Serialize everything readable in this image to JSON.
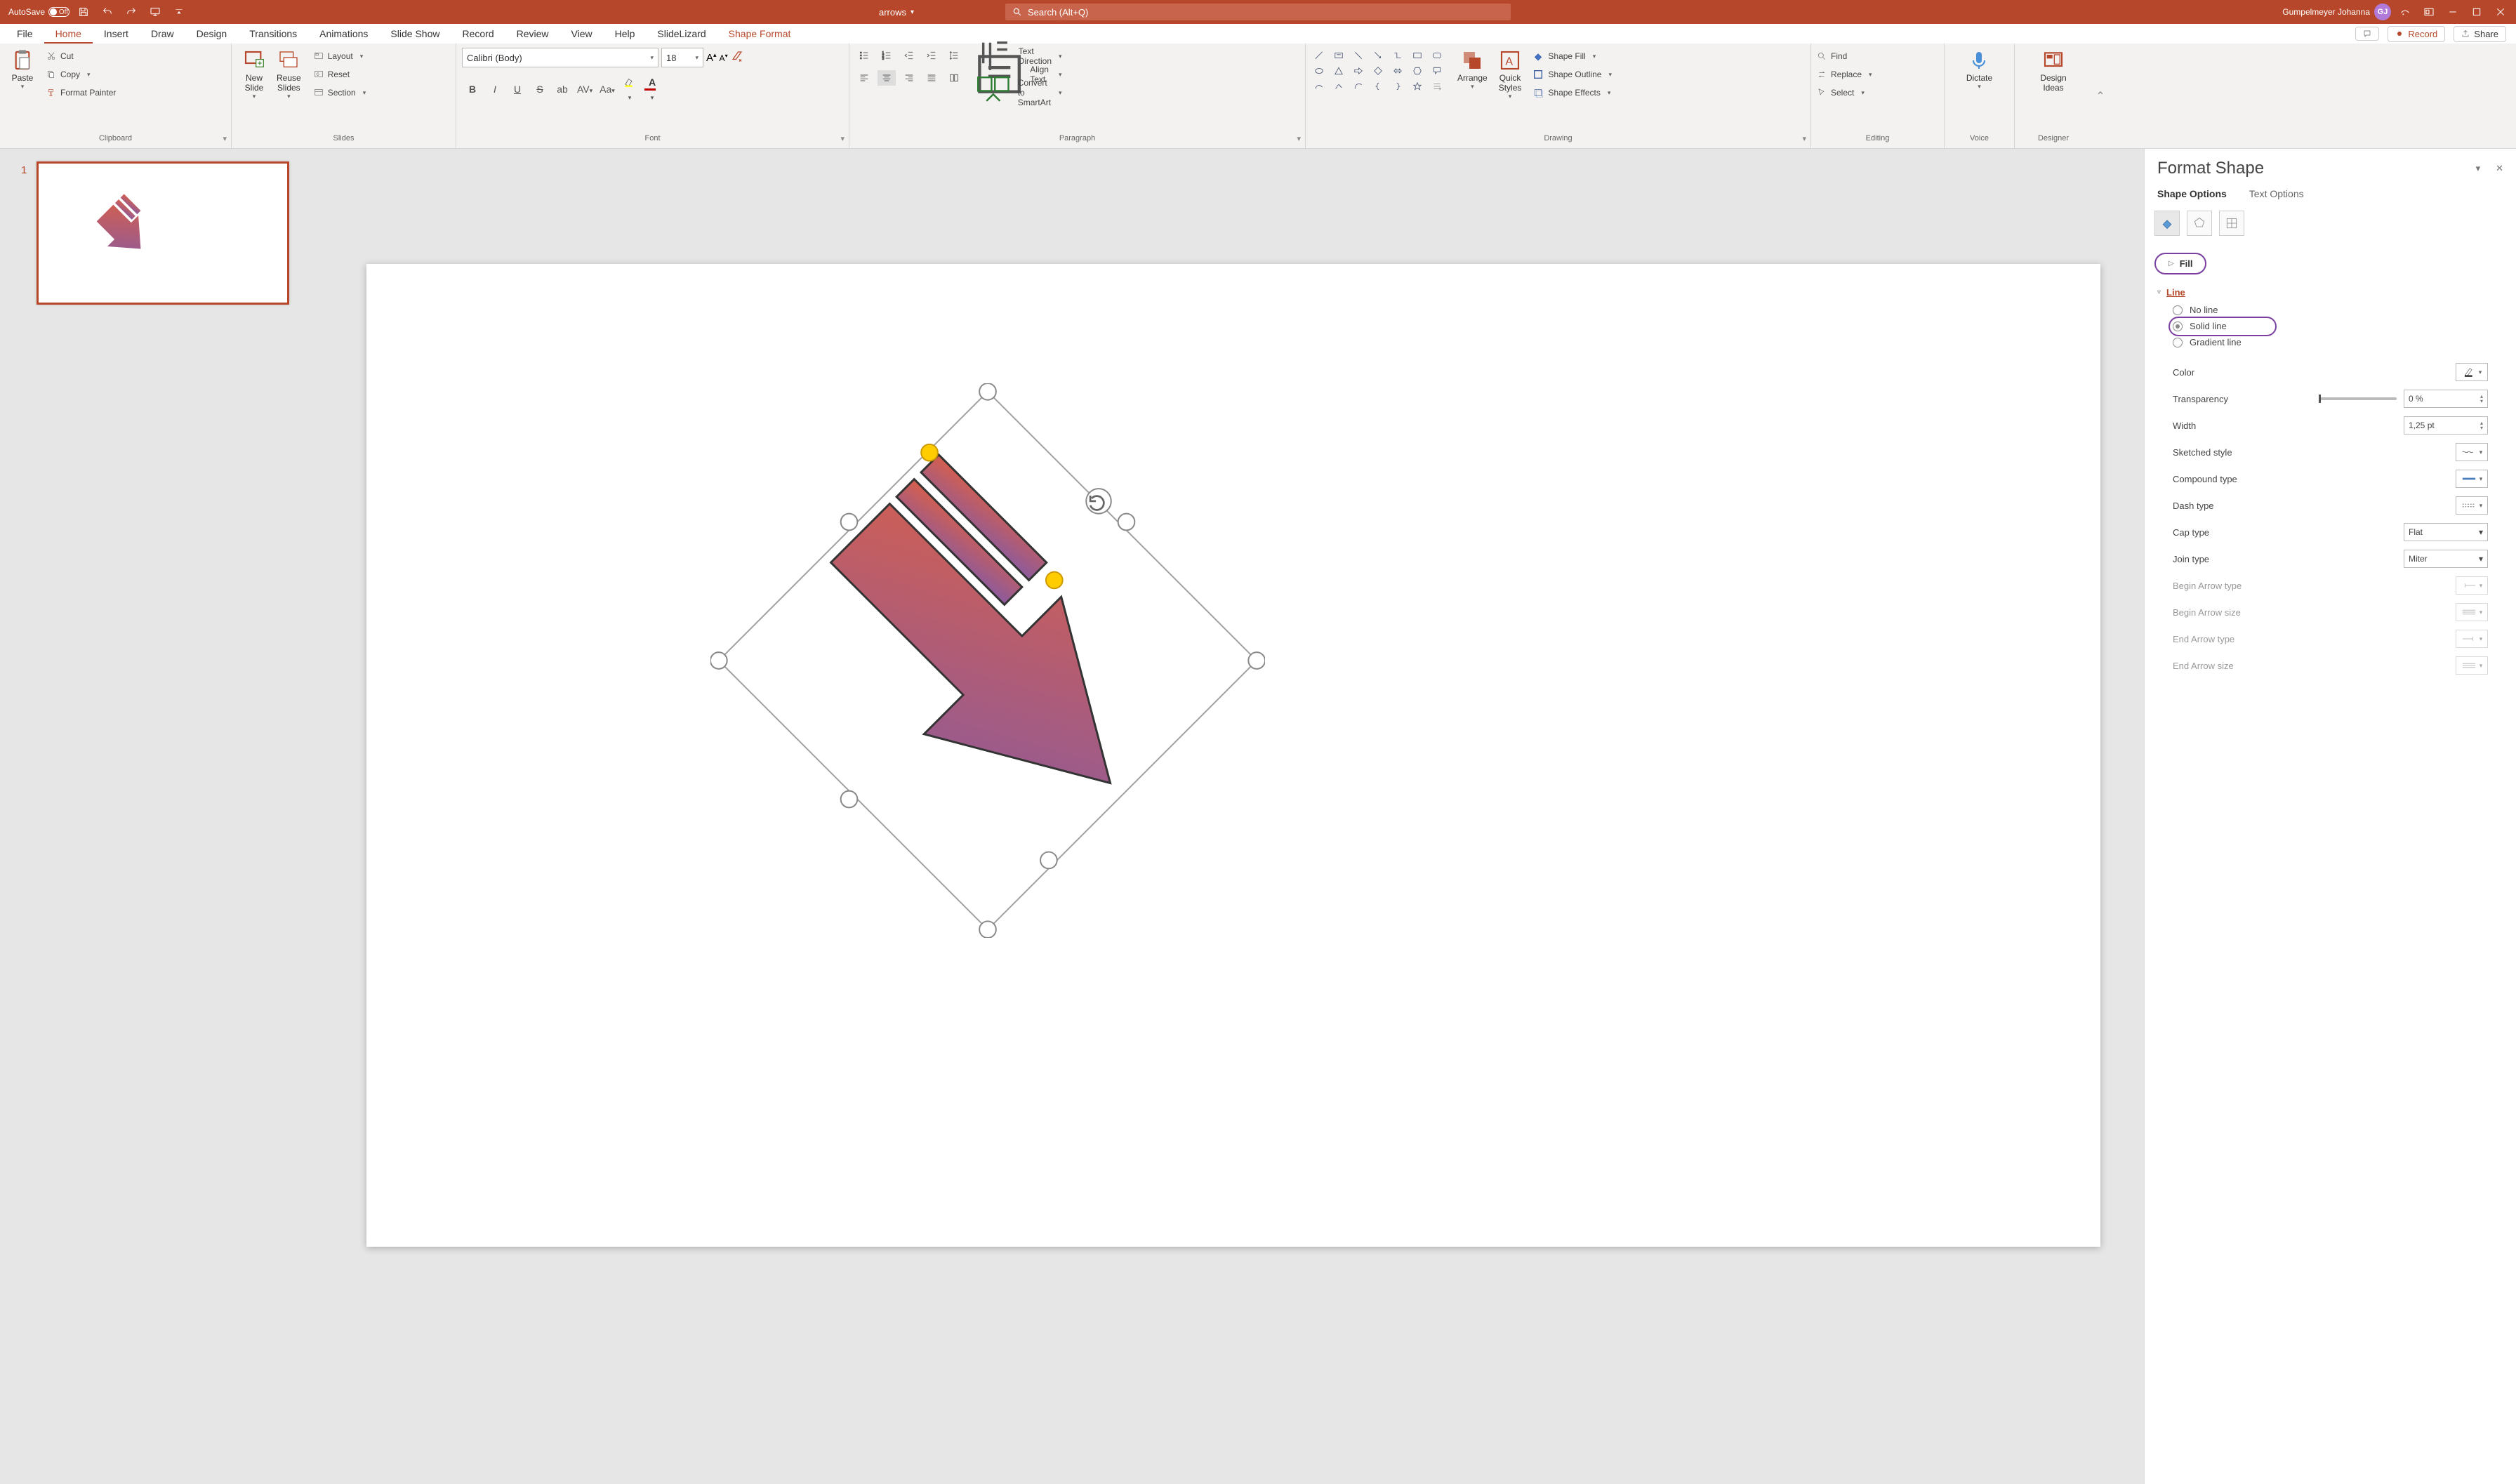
{
  "titlebar": {
    "autosave_label": "AutoSave",
    "autosave_state": "Off",
    "doc_name": "arrows",
    "search_placeholder": "Search (Alt+Q)",
    "user_name": "Gumpelmeyer Johanna",
    "user_initials": "GJ"
  },
  "tabs": {
    "items": [
      "File",
      "Home",
      "Insert",
      "Draw",
      "Design",
      "Transitions",
      "Animations",
      "Slide Show",
      "Record",
      "Review",
      "View",
      "Help",
      "SlideLizard",
      "Shape Format"
    ],
    "active_idx": 1,
    "accent_idx": 13,
    "comments": "Comments",
    "record": "Record",
    "share": "Share"
  },
  "ribbon": {
    "clipboard": {
      "paste": "Paste",
      "cut": "Cut",
      "copy": "Copy",
      "format_painter": "Format Painter",
      "label": "Clipboard"
    },
    "slides": {
      "new_slide": "New\nSlide",
      "reuse": "Reuse\nSlides",
      "layout": "Layout",
      "reset": "Reset",
      "section": "Section",
      "label": "Slides"
    },
    "font": {
      "name": "Calibri (Body)",
      "size": "18",
      "label": "Font"
    },
    "paragraph": {
      "text_direction": "Text Direction",
      "align_text": "Align Text",
      "smartart": "Convert to SmartArt",
      "label": "Paragraph"
    },
    "drawing": {
      "arrange": "Arrange",
      "quick_styles": "Quick\nStyles",
      "shape_fill": "Shape Fill",
      "shape_outline": "Shape Outline",
      "shape_effects": "Shape Effects",
      "label": "Drawing"
    },
    "editing": {
      "find": "Find",
      "replace": "Replace",
      "select": "Select",
      "label": "Editing"
    },
    "voice": {
      "dictate": "Dictate",
      "label": "Voice"
    },
    "designer": {
      "design_ideas": "Design\nIdeas",
      "label": "Designer"
    }
  },
  "thumb": {
    "num": "1"
  },
  "pane": {
    "title": "Format Shape",
    "tab_shape": "Shape Options",
    "tab_text": "Text Options",
    "fill": "Fill",
    "line": "Line",
    "no_line": "No line",
    "solid_line": "Solid line",
    "gradient_line": "Gradient line",
    "color": "Color",
    "transparency": "Transparency",
    "transparency_val": "0 %",
    "width": "Width",
    "width_val": "1,25 pt",
    "sketched": "Sketched style",
    "compound": "Compound type",
    "dash": "Dash type",
    "cap": "Cap type",
    "cap_val": "Flat",
    "join": "Join type",
    "join_val": "Miter",
    "begin_arrow_type": "Begin Arrow type",
    "begin_arrow_size": "Begin Arrow size",
    "end_arrow_type": "End Arrow type",
    "end_arrow_size": "End Arrow size"
  }
}
